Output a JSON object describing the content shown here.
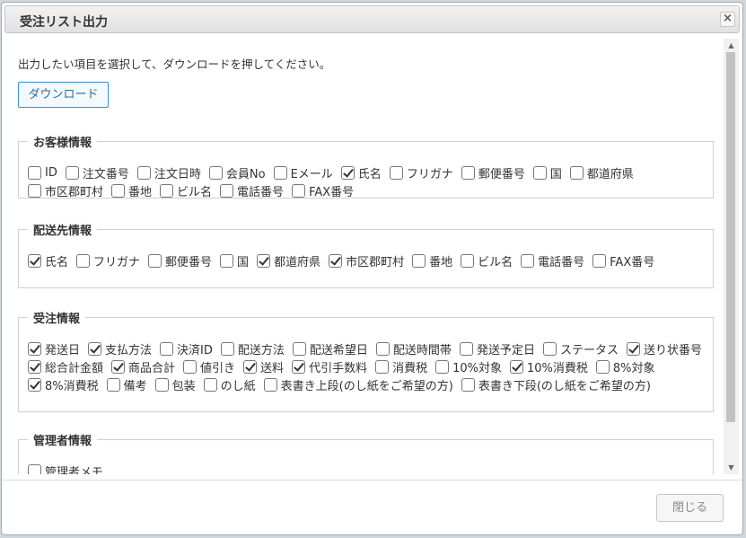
{
  "dialog": {
    "title": "受注リスト出力",
    "close_icon": "×"
  },
  "intro": "出力したい項目を選択して、ダウンロードを押してください。",
  "download_label": "ダウンロード",
  "sections": [
    {
      "title": "お客様情報",
      "options": [
        {
          "label": "ID",
          "checked": false
        },
        {
          "label": "注文番号",
          "checked": false
        },
        {
          "label": "注文日時",
          "checked": false
        },
        {
          "label": "会員No",
          "checked": false
        },
        {
          "label": "Eメール",
          "checked": false
        },
        {
          "label": "氏名",
          "checked": true
        },
        {
          "label": "フリガナ",
          "checked": false
        },
        {
          "label": "郵便番号",
          "checked": false
        },
        {
          "label": "国",
          "checked": false
        },
        {
          "label": "都道府県",
          "checked": false
        },
        {
          "label": "市区郡町村",
          "checked": false
        },
        {
          "label": "番地",
          "checked": false
        },
        {
          "label": "ビル名",
          "checked": false
        },
        {
          "label": "電話番号",
          "checked": false
        },
        {
          "label": "FAX番号",
          "checked": false
        }
      ]
    },
    {
      "title": "配送先情報",
      "options": [
        {
          "label": "氏名",
          "checked": true
        },
        {
          "label": "フリガナ",
          "checked": false
        },
        {
          "label": "郵便番号",
          "checked": false
        },
        {
          "label": "国",
          "checked": false
        },
        {
          "label": "都道府県",
          "checked": true
        },
        {
          "label": "市区郡町村",
          "checked": true
        },
        {
          "label": "番地",
          "checked": false
        },
        {
          "label": "ビル名",
          "checked": false
        },
        {
          "label": "電話番号",
          "checked": false
        },
        {
          "label": "FAX番号",
          "checked": false
        }
      ]
    },
    {
      "title": "受注情報",
      "options": [
        {
          "label": "発送日",
          "checked": true
        },
        {
          "label": "支払方法",
          "checked": true
        },
        {
          "label": "決済ID",
          "checked": false
        },
        {
          "label": "配送方法",
          "checked": false
        },
        {
          "label": "配送希望日",
          "checked": false
        },
        {
          "label": "配送時間帯",
          "checked": false
        },
        {
          "label": "発送予定日",
          "checked": false
        },
        {
          "label": "ステータス",
          "checked": false
        },
        {
          "label": "送り状番号",
          "checked": true
        },
        {
          "label": "総合計金額",
          "checked": true
        },
        {
          "label": "商品合計",
          "checked": true
        },
        {
          "label": "値引き",
          "checked": false
        },
        {
          "label": "送料",
          "checked": true
        },
        {
          "label": "代引手数料",
          "checked": true
        },
        {
          "label": "消費税",
          "checked": false
        },
        {
          "label": "10%対象",
          "checked": false
        },
        {
          "label": "10%消費税",
          "checked": true
        },
        {
          "label": "8%対象",
          "checked": false
        },
        {
          "label": "8%消費税",
          "checked": true
        },
        {
          "label": "備考",
          "checked": false
        },
        {
          "label": "包装",
          "checked": false
        },
        {
          "label": "のし紙",
          "checked": false
        },
        {
          "label": "表書き上段(のし紙をご希望の方)",
          "checked": false
        },
        {
          "label": "表書き下段(のし紙をご希望の方)",
          "checked": false
        }
      ]
    },
    {
      "title": "管理者情報",
      "options": [
        {
          "label": "管理者メモ",
          "checked": false
        }
      ]
    }
  ],
  "close_label": "閉じる"
}
